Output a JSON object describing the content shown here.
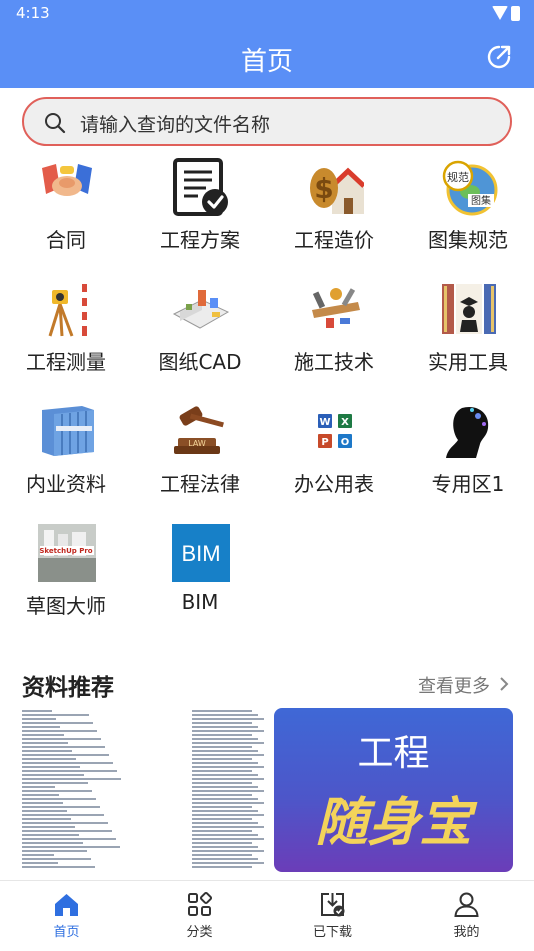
{
  "status_bar": {
    "time": "4:13"
  },
  "app_bar": {
    "title": "首页"
  },
  "search": {
    "placeholder": "请输入查询的文件名称"
  },
  "categories": [
    {
      "label": "合同",
      "icon": "handshake-icon"
    },
    {
      "label": "工程方案",
      "icon": "document-check-icon"
    },
    {
      "label": "工程造价",
      "icon": "house-money-icon"
    },
    {
      "label": "图集规范",
      "icon": "globe-standards-icon"
    },
    {
      "label": "工程测量",
      "icon": "surveying-instrument-icon"
    },
    {
      "label": "图纸CAD",
      "icon": "floorplan-icon"
    },
    {
      "label": "施工技术",
      "icon": "tools-icon"
    },
    {
      "label": "实用工具",
      "icon": "graduation-icon"
    },
    {
      "label": "内业资料",
      "icon": "binders-icon"
    },
    {
      "label": "工程法律",
      "icon": "gavel-icon"
    },
    {
      "label": "办公用表",
      "icon": "office-apps-icon"
    },
    {
      "label": "专用区1",
      "icon": "thinker-icon"
    },
    {
      "label": "草图大师",
      "icon": "sketchup-icon"
    },
    {
      "label": "BIM",
      "icon": "bim-icon",
      "icon_text": "BIM"
    }
  ],
  "recommend": {
    "title": "资料推荐",
    "more_label": "查看更多",
    "promo_line1": "工程",
    "promo_line2": "随身宝"
  },
  "tabs": [
    {
      "label": "首页",
      "icon": "home-icon",
      "active": true
    },
    {
      "label": "分类",
      "icon": "grid-category-icon",
      "active": false
    },
    {
      "label": "已下载",
      "icon": "downloaded-icon",
      "active": false
    },
    {
      "label": "我的",
      "icon": "profile-icon",
      "active": false
    }
  ],
  "colors": {
    "primary": "#5a8ff6",
    "search_border": "#e0605a",
    "tab_active": "#2f6fe0",
    "promo_text": "#f3d35a"
  }
}
